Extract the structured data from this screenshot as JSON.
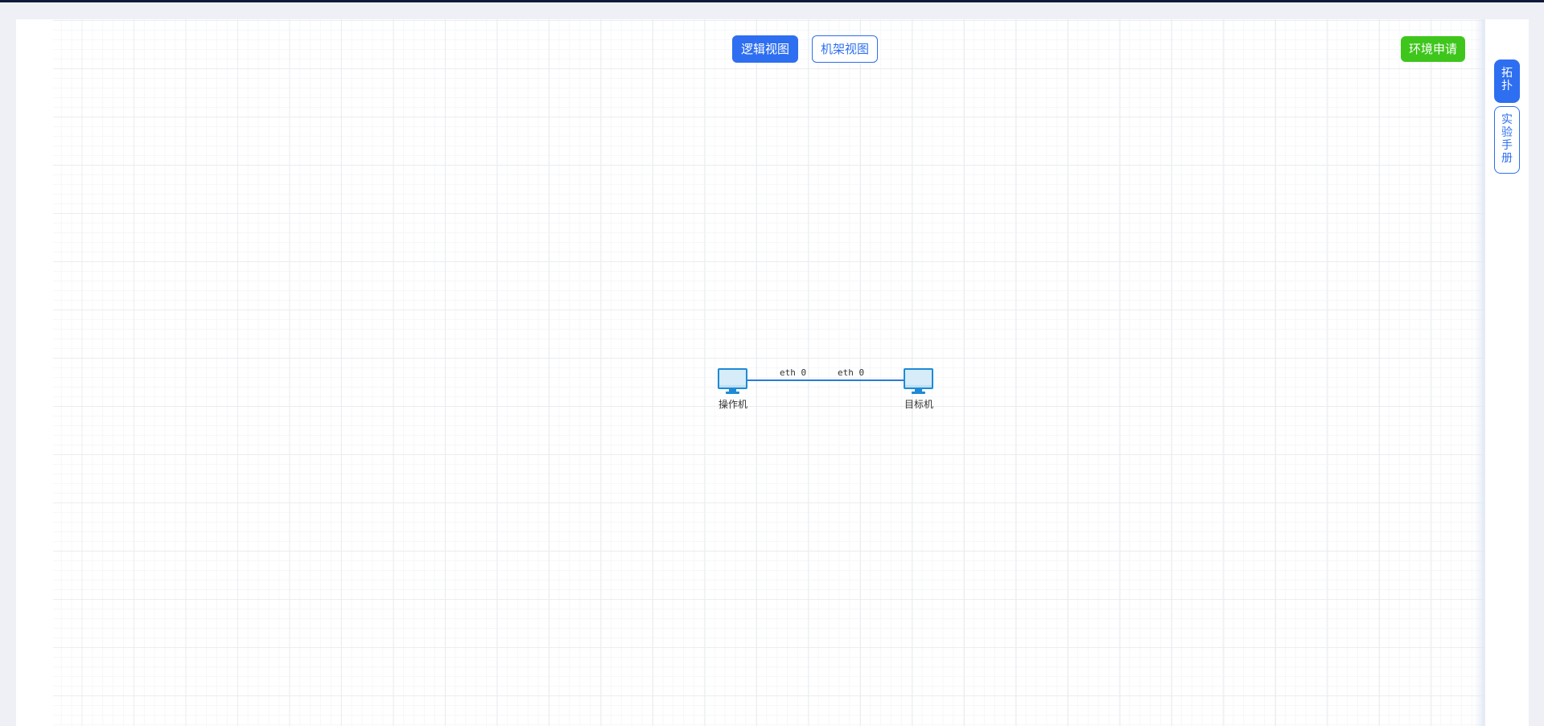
{
  "toolbar": {
    "logic_view_label": "逻辑视图",
    "rack_view_label": "机架视图",
    "apply_env_label": "环境申请"
  },
  "sidebar": {
    "tabs": [
      {
        "chars": [
          "拓",
          "扑"
        ],
        "active": true
      },
      {
        "chars": [
          "实",
          "验",
          "手",
          "册"
        ],
        "active": false
      }
    ]
  },
  "topology": {
    "nodes": [
      {
        "id": "operator",
        "label": "操作机",
        "icon": "desktop-computer-icon"
      },
      {
        "id": "target",
        "label": "目标机",
        "icon": "desktop-computer-icon"
      }
    ],
    "link": {
      "from": "operator",
      "to": "target",
      "from_port": "eth 0",
      "to_port": "eth 0"
    }
  },
  "colors": {
    "primary": "#2d6ff0",
    "success": "#3ec61c",
    "link": "#2b7ad6",
    "node_border": "#1e8ad6",
    "node_fill": "#d6ecf8",
    "topbar": "#0f1a3c",
    "background": "#eef0f5"
  }
}
